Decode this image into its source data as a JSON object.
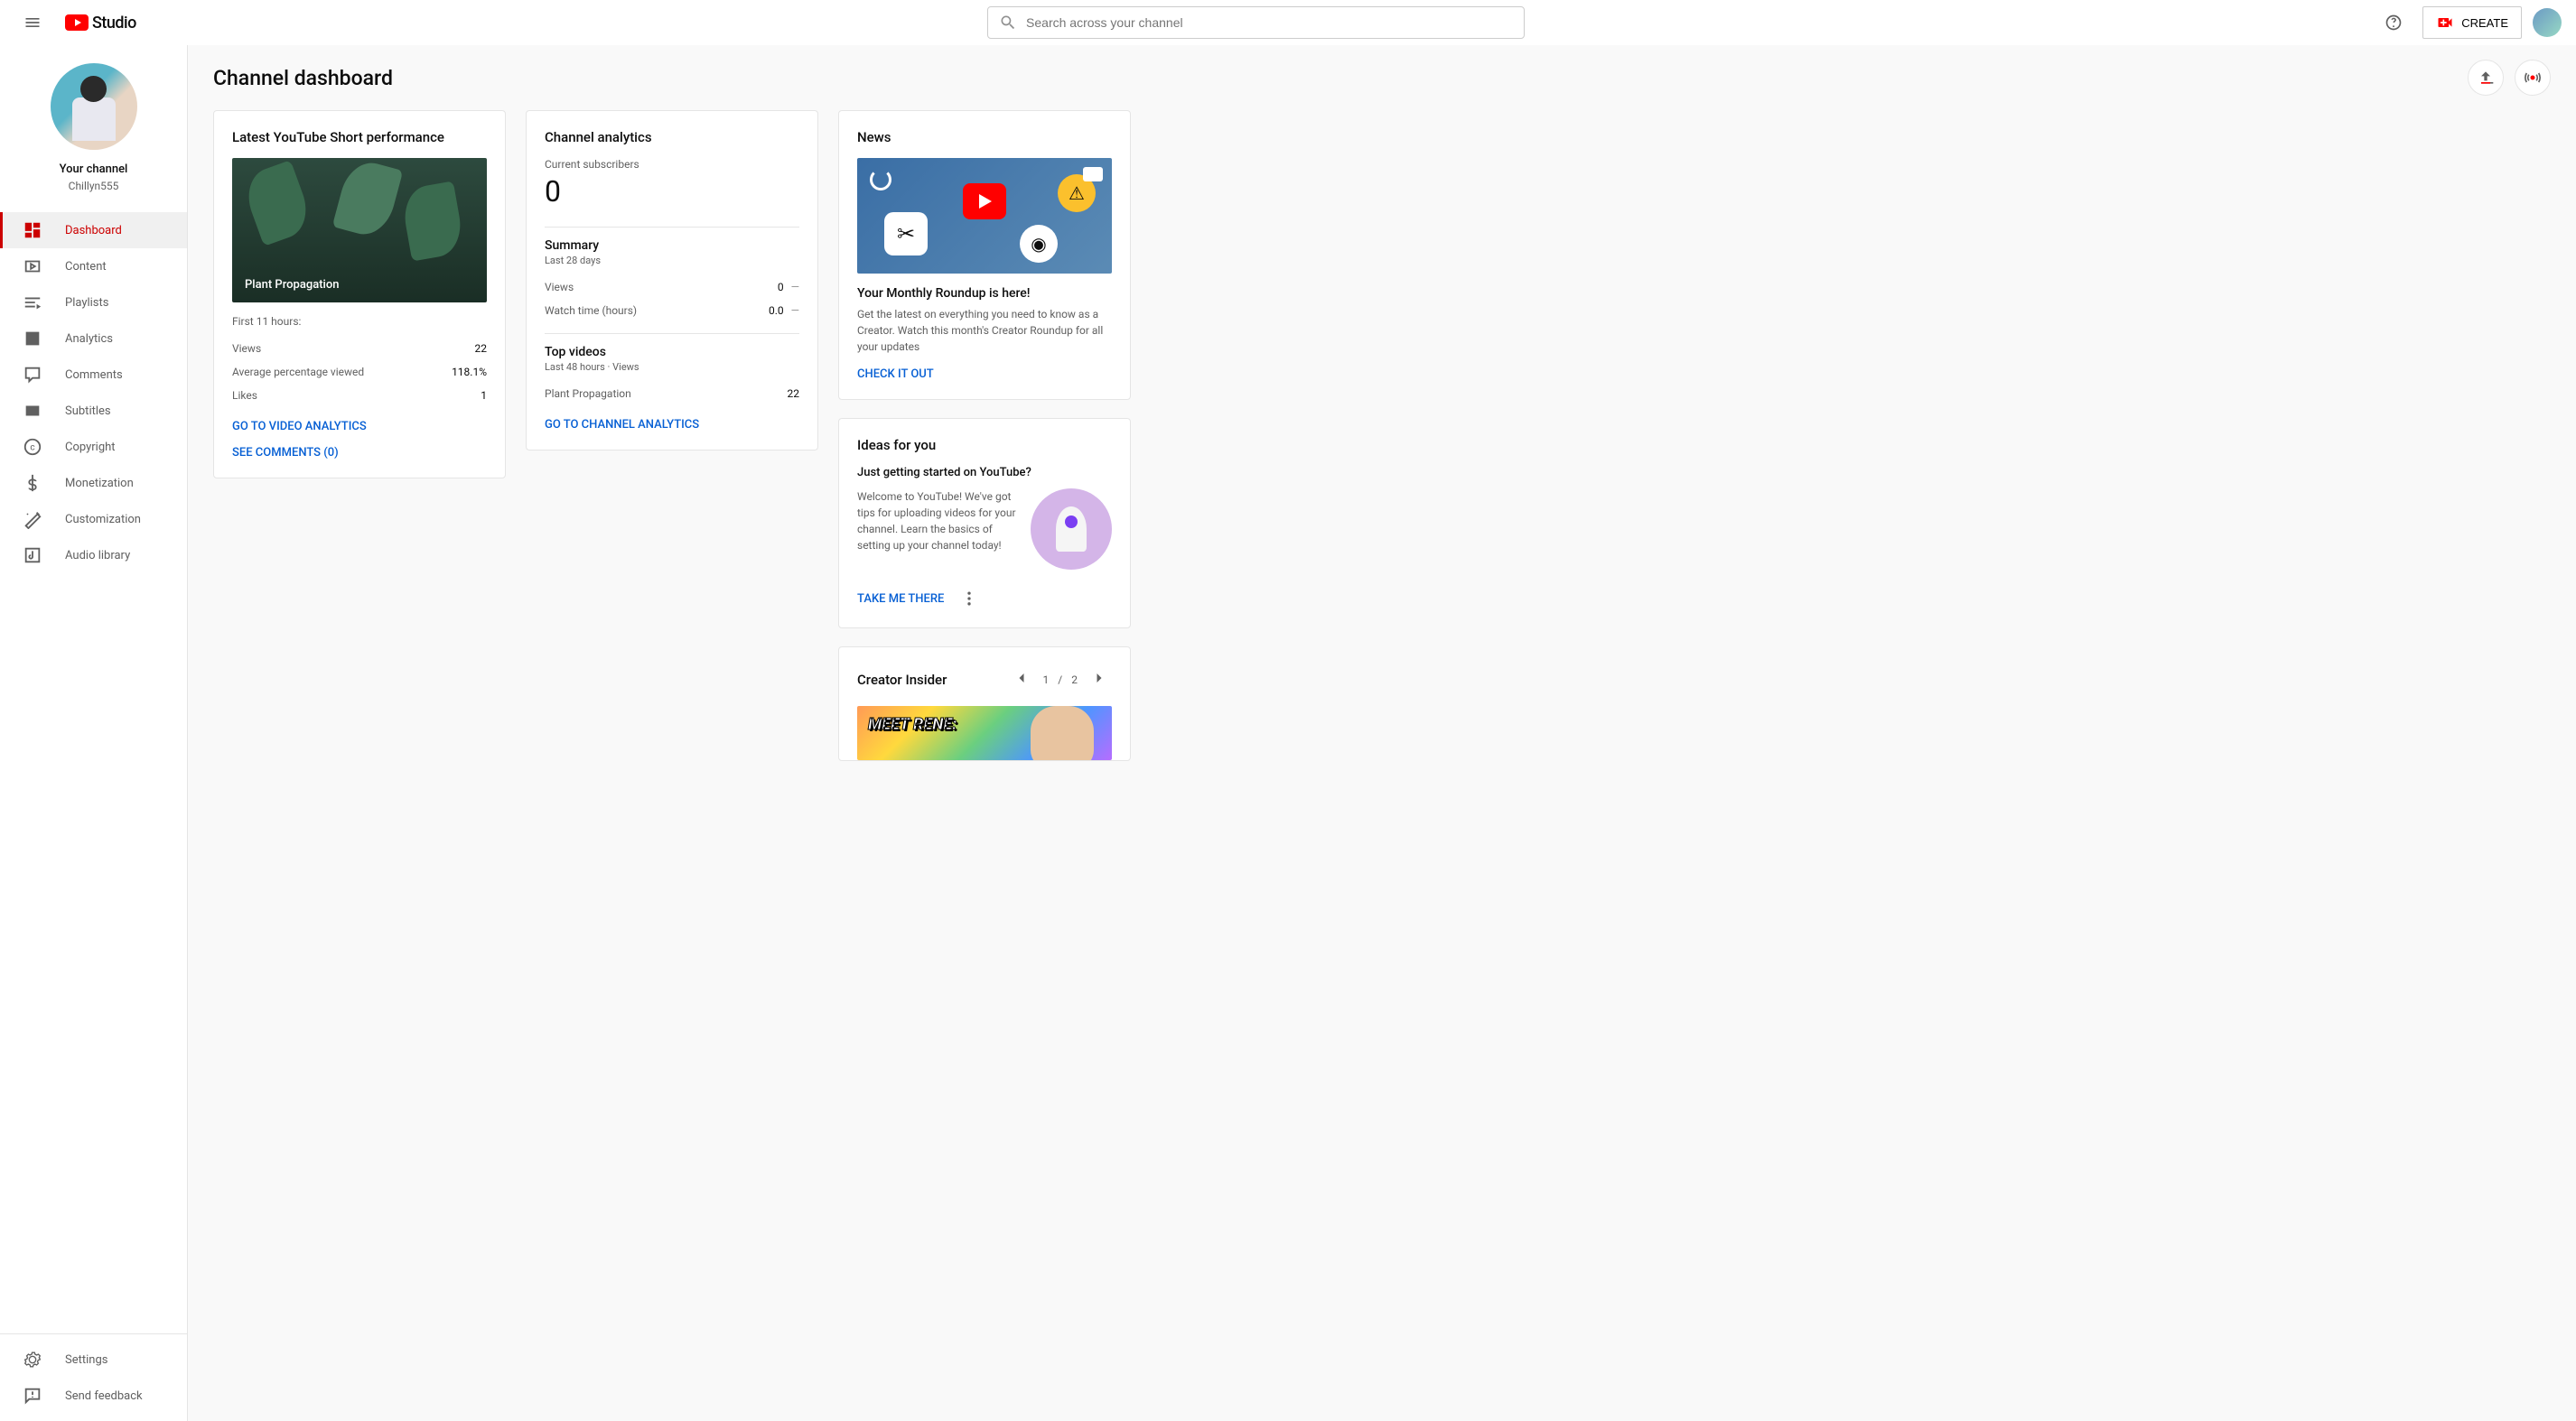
{
  "header": {
    "logo_text": "Studio",
    "search_placeholder": "Search across your channel",
    "create_label": "CREATE"
  },
  "sidebar": {
    "profile_title": "Your channel",
    "profile_name": "Chillyn555",
    "items": [
      {
        "label": "Dashboard"
      },
      {
        "label": "Content"
      },
      {
        "label": "Playlists"
      },
      {
        "label": "Analytics"
      },
      {
        "label": "Comments"
      },
      {
        "label": "Subtitles"
      },
      {
        "label": "Copyright"
      },
      {
        "label": "Monetization"
      },
      {
        "label": "Customization"
      },
      {
        "label": "Audio library"
      }
    ],
    "footer": [
      {
        "label": "Settings"
      },
      {
        "label": "Send feedback"
      }
    ]
  },
  "page": {
    "title": "Channel dashboard"
  },
  "latest": {
    "title": "Latest YouTube Short performance",
    "video_title": "Plant Propagation",
    "window": "First 11 hours:",
    "rows": [
      {
        "label": "Views",
        "value": "22"
      },
      {
        "label": "Average percentage viewed",
        "value": "118.1%"
      },
      {
        "label": "Likes",
        "value": "1"
      }
    ],
    "link_analytics": "GO TO VIDEO ANALYTICS",
    "link_comments": "SEE COMMENTS (0)"
  },
  "analytics": {
    "title": "Channel analytics",
    "sub_label": "Current subscribers",
    "sub_count": "0",
    "summary_title": "Summary",
    "summary_sub": "Last 28 days",
    "summary_rows": [
      {
        "label": "Views",
        "value": "0",
        "delta": "—"
      },
      {
        "label": "Watch time (hours)",
        "value": "0.0",
        "delta": "—"
      }
    ],
    "top_title": "Top videos",
    "top_sub": "Last 48 hours · Views",
    "top_rows": [
      {
        "label": "Plant Propagation",
        "value": "22"
      }
    ],
    "link": "GO TO CHANNEL ANALYTICS"
  },
  "news": {
    "title": "News",
    "headline": "Your Monthly Roundup is here!",
    "desc": "Get the latest on everything you need to know as a Creator. Watch this month's Creator Roundup for all your updates",
    "link": "CHECK IT OUT"
  },
  "ideas": {
    "title": "Ideas for you",
    "headline": "Just getting started on YouTube?",
    "desc": "Welcome to YouTube! We've got tips for uploading videos for your channel. Learn the basics of setting up your channel today!",
    "link": "TAKE ME THERE"
  },
  "insider": {
    "title": "Creator Insider",
    "page_current": "1",
    "page_sep": "/",
    "page_total": "2",
    "thumb_text": "MEET RENE:"
  }
}
